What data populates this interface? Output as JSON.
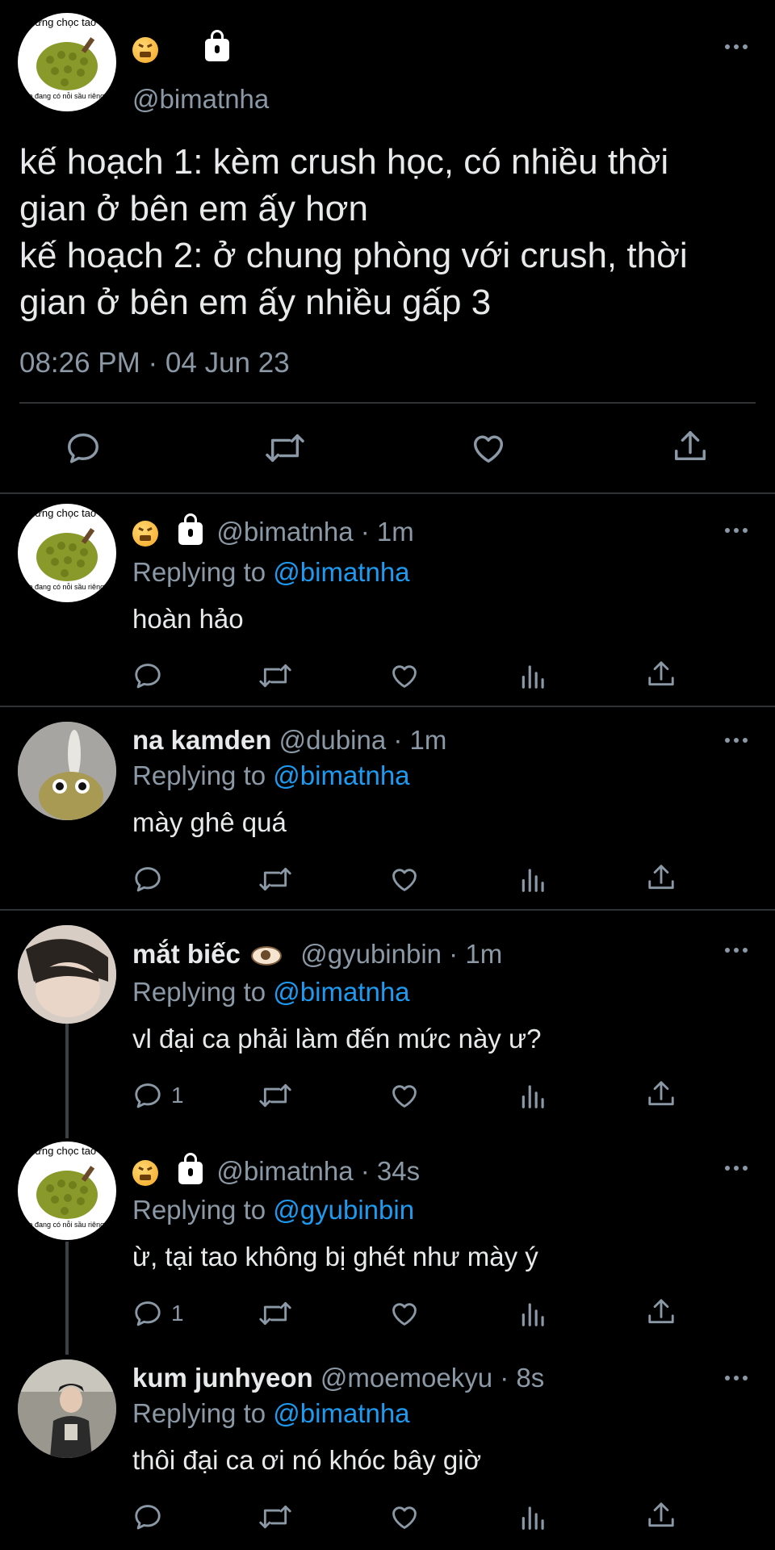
{
  "main": {
    "avatar_caption_top": "đừng chọc tao",
    "avatar_caption_bottom": "tao đang có nỗi sầu riêng",
    "handle": "@bimatnha",
    "text_line1": "kế hoạch 1: kèm crush học, có nhiều thời",
    "text_line2": "gian ở bên em ấy hơn",
    "text_line3": "kế hoạch 2: ở chung phòng với crush, thời",
    "text_line4": "gian ở bên em ấy nhiều gấp 3",
    "timestamp": "08:26 PM · 04 Jun 23"
  },
  "replies": [
    {
      "display_name": "",
      "handle_time": "@bimatnha · 1m",
      "replying_label": "Replying to",
      "replying_to": "@bimatnha",
      "text": "hoàn hảo",
      "reply_count": ""
    },
    {
      "display_name": "na kamden",
      "handle_time": "@dubina · 1m",
      "replying_label": "Replying to",
      "replying_to": "@bimatnha",
      "text": "mày ghê quá",
      "reply_count": ""
    },
    {
      "display_name": "mắt biếc",
      "handle_time": "@gyubinbin · 1m",
      "replying_label": "Replying to",
      "replying_to": "@bimatnha",
      "text": "vl đại ca phải làm đến mức này ư?",
      "reply_count": "1"
    },
    {
      "display_name": "",
      "handle_time": "@bimatnha · 34s",
      "replying_label": "Replying to",
      "replying_to": "@gyubinbin",
      "text": "ừ, tại tao không bị ghét như mày ý",
      "reply_count": "1"
    },
    {
      "display_name": "kum junhyeon",
      "handle_time": "@moemoekyu · 8s",
      "replying_label": "Replying to",
      "replying_to": "@bimatnha",
      "text": "thôi đại ca ơi nó khóc bây giờ",
      "reply_count": ""
    }
  ],
  "icons": [
    "reply-icon",
    "retweet-icon",
    "like-icon",
    "analytics-icon",
    "share-icon",
    "more-icon",
    "lock-icon",
    "tired-face-emoji",
    "eye-emoji"
  ],
  "colors": {
    "background": "#000000",
    "text": "#e7e9ea",
    "secondary": "#8b98a5",
    "link": "#1d9bf0",
    "divider": "#2f3336"
  }
}
